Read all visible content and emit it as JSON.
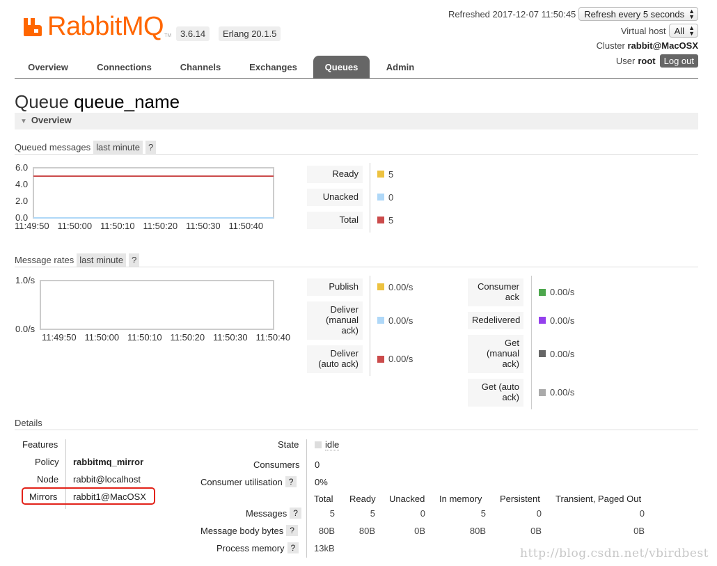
{
  "header": {
    "logo_text": "RabbitMQ",
    "logo_tm": "TM",
    "version": "3.6.14",
    "erlang": "Erlang 20.1.5",
    "refreshed": "Refreshed 2017-12-07 11:50:45",
    "refresh_select": "Refresh every 5 seconds",
    "vhost_label": "Virtual host",
    "vhost_select": "All",
    "cluster_label": "Cluster",
    "cluster_name": "rabbit@MacOSX",
    "user_label": "User",
    "user_name": "root",
    "logout": "Log out"
  },
  "nav": {
    "tabs": [
      "Overview",
      "Connections",
      "Channels",
      "Exchanges",
      "Queues",
      "Admin"
    ],
    "active": "Queues"
  },
  "page": {
    "title_prefix": "Queue",
    "queue_name": "queue_name",
    "section": "Overview"
  },
  "queued": {
    "label": "Queued messages",
    "range": "last minute",
    "help": "?",
    "legend": [
      {
        "label": "Ready",
        "value": "5",
        "color": "#edc240"
      },
      {
        "label": "Unacked",
        "value": "0",
        "color": "#afd8f8"
      },
      {
        "label": "Total",
        "value": "5",
        "color": "#cb4b4b"
      }
    ]
  },
  "rates": {
    "label": "Message rates",
    "range": "last minute",
    "help": "?",
    "legend_left": [
      {
        "label": "Publish",
        "value": "0.00/s",
        "color": "#edc240"
      },
      {
        "label": "Deliver (manual ack)",
        "value": "0.00/s",
        "color": "#afd8f8"
      },
      {
        "label": "Deliver (auto ack)",
        "value": "0.00/s",
        "color": "#cb4b4b"
      }
    ],
    "legend_right": [
      {
        "label": "Consumer ack",
        "value": "0.00/s",
        "color": "#4da74d"
      },
      {
        "label": "Redelivered",
        "value": "0.00/s",
        "color": "#9440ed"
      },
      {
        "label": "Get (manual ack)",
        "value": "0.00/s",
        "color": "#666666"
      },
      {
        "label": "Get (auto ack)",
        "value": "0.00/s",
        "color": "#aaaaaa"
      }
    ]
  },
  "chart_data": [
    {
      "type": "line",
      "x": [
        "11:49:50",
        "11:50:00",
        "11:50:10",
        "11:50:20",
        "11:50:30",
        "11:50:40"
      ],
      "yticks": [
        "6.0",
        "4.0",
        "2.0",
        "0.0"
      ],
      "ylim": [
        0,
        6
      ],
      "series": [
        {
          "name": "Total",
          "values": [
            5,
            5,
            5,
            5,
            5,
            5
          ],
          "color": "#cb4b4b"
        },
        {
          "name": "Ready",
          "values": [
            5,
            5,
            5,
            5,
            5,
            5
          ],
          "color": "#edc240"
        },
        {
          "name": "Unacked",
          "values": [
            0,
            0,
            0,
            0,
            0,
            0
          ],
          "color": "#afd8f8"
        }
      ]
    },
    {
      "type": "line",
      "x": [
        "11:49:50",
        "11:50:00",
        "11:50:10",
        "11:50:20",
        "11:50:30",
        "11:50:40"
      ],
      "yticks": [
        "1.0/s",
        "0.0/s"
      ],
      "ylim": [
        0,
        1
      ],
      "series": []
    }
  ],
  "details": {
    "label": "Details",
    "features_label": "Features",
    "policy_label": "Policy",
    "policy": "rabbitmq_mirror",
    "node_label": "Node",
    "node": "rabbit@localhost",
    "mirrors_label": "Mirrors",
    "mirrors": "rabbit1@MacOSX",
    "state_label": "State",
    "state": "idle",
    "consumers_label": "Consumers",
    "consumers": "0",
    "util_label": "Consumer utilisation",
    "util": "0%",
    "help": "?",
    "columns": [
      "Total",
      "Ready",
      "Unacked",
      "In memory",
      "Persistent",
      "Transient, Paged Out"
    ],
    "messages_label": "Messages",
    "messages": [
      "5",
      "5",
      "0",
      "5",
      "0",
      "0"
    ],
    "bytes_label": "Message body bytes",
    "bytes": [
      "80B",
      "80B",
      "0B",
      "80B",
      "0B",
      "0B"
    ],
    "procmem_label": "Process memory",
    "procmem": "13kB"
  },
  "watermark": "http://blog.csdn.net/vbirdbest"
}
